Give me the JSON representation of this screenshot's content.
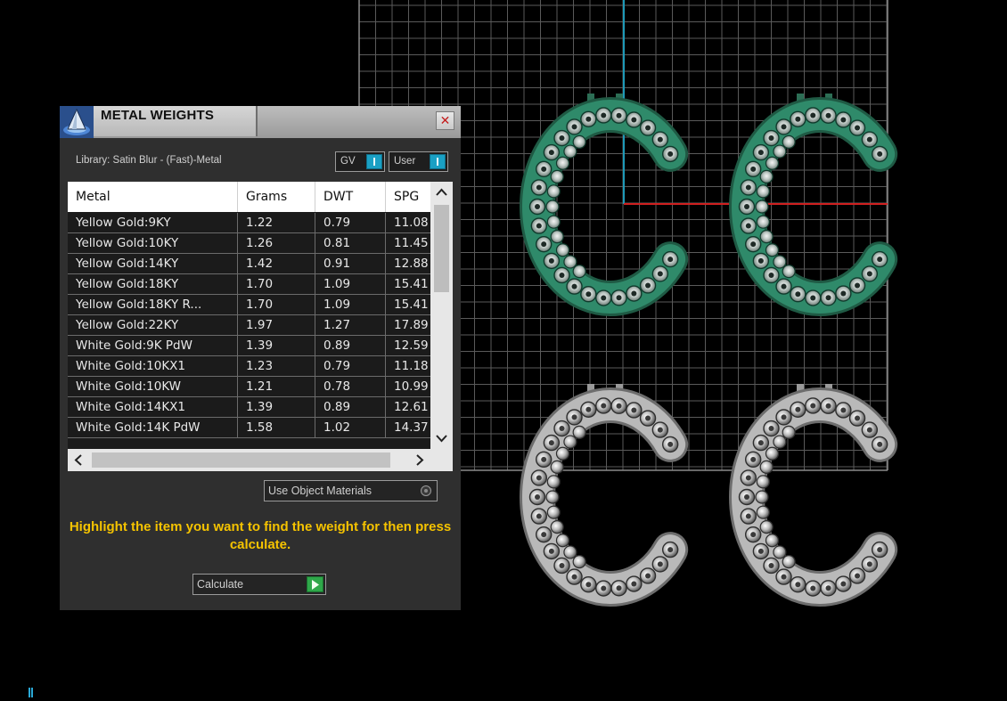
{
  "panel": {
    "title": "METAL WEIGHTS",
    "close_label": "✕",
    "library_label": "Library: Satin Blur - (Fast)-Metal",
    "gv_label": "GV",
    "user_label": "User",
    "columns": [
      "Metal",
      "Grams",
      "DWT",
      "SPG"
    ],
    "rows": [
      {
        "metal": "Yellow Gold:9KY",
        "grams": "1.22",
        "dwt": "0.79",
        "spg": "11.08"
      },
      {
        "metal": "Yellow Gold:10KY",
        "grams": "1.26",
        "dwt": "0.81",
        "spg": "11.45"
      },
      {
        "metal": "Yellow Gold:14KY",
        "grams": "1.42",
        "dwt": "0.91",
        "spg": "12.88"
      },
      {
        "metal": "Yellow Gold:18KY",
        "grams": "1.70",
        "dwt": "1.09",
        "spg": "15.41"
      },
      {
        "metal": "Yellow Gold:18KY R...",
        "grams": "1.70",
        "dwt": "1.09",
        "spg": "15.41"
      },
      {
        "metal": "Yellow Gold:22KY",
        "grams": "1.97",
        "dwt": "1.27",
        "spg": "17.89"
      },
      {
        "metal": "White Gold:9K PdW",
        "grams": "1.39",
        "dwt": "0.89",
        "spg": "12.59"
      },
      {
        "metal": "White Gold:10KX1",
        "grams": "1.23",
        "dwt": "0.79",
        "spg": "11.18"
      },
      {
        "metal": "White Gold:10KW",
        "grams": "1.21",
        "dwt": "0.78",
        "spg": "10.99"
      },
      {
        "metal": "White Gold:14KX1",
        "grams": "1.39",
        "dwt": "0.89",
        "spg": "12.61"
      },
      {
        "metal": "White Gold:14K PdW",
        "grams": "1.58",
        "dwt": "1.02",
        "spg": "14.37"
      }
    ],
    "use_object_materials_label": "Use Object Materials",
    "hint": "Highlight the item you want to find the weight for then press calculate.",
    "calculate_label": "Calculate"
  },
  "colors": {
    "accent_blue": "#1aa0c4",
    "hint_yellow": "#f5c300",
    "go_green": "#2fa84a",
    "gem_teal": "#2f8a6a",
    "axis_red": "#d02020",
    "axis_cyan": "#1e9ab8"
  }
}
